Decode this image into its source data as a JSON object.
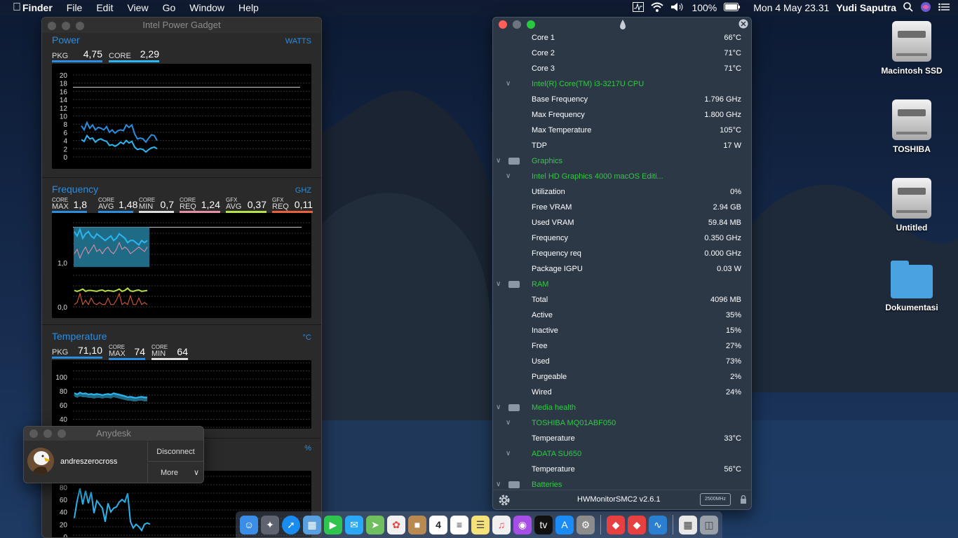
{
  "menubar": {
    "apple": "",
    "app": "Finder",
    "items": [
      "File",
      "Edit",
      "View",
      "Go",
      "Window",
      "Help"
    ],
    "battery": "100%",
    "datetime": "Mon 4 May  23.31",
    "user": "Yudi Saputra"
  },
  "ipg": {
    "title": "Intel Power Gadget",
    "power": {
      "title": "Power",
      "unit": "WATTS",
      "pkg_label": "PKG",
      "pkg_value": "4,75",
      "core_label": "CORE",
      "core_value": "2,29",
      "ticks": [
        "20",
        "18",
        "16",
        "14",
        "12",
        "10",
        "8",
        "6",
        "4",
        "2",
        "0"
      ],
      "pkg_series": [
        7.6,
        6.6,
        8.4,
        7,
        7.8,
        6.6,
        7.2,
        7,
        6.6,
        7.4,
        6,
        6.6,
        5.8,
        6.4,
        6.6,
        6.4,
        7.8,
        7.2,
        7.8,
        5.6,
        4.4,
        4.6,
        4.4,
        3.6,
        4.6,
        5.4,
        5.2,
        4
      ],
      "core_series": [
        4.2,
        3.8,
        5.2,
        4.4,
        4.6,
        3.6,
        4.2,
        4.4,
        4,
        3.8,
        2.8,
        3,
        2.6,
        3,
        3.6,
        3.2,
        4,
        3.4,
        3.8,
        2.4,
        1.8,
        2,
        1.8,
        1.2,
        1.8,
        2.2,
        2.4,
        2
      ]
    },
    "frequency": {
      "title": "Frequency",
      "unit": "GHZ",
      "metrics": [
        {
          "top": "CORE",
          "bottom": "MAX",
          "value": "1,8",
          "color": "#2b8de0"
        },
        {
          "top": "CORE",
          "bottom": "AVG",
          "value": "1,48",
          "color": "#2b8de0"
        },
        {
          "top": "CORE",
          "bottom": "MIN",
          "value": "0,7",
          "color": "#dddddd"
        },
        {
          "top": "CORE",
          "bottom": "REQ",
          "value": "1,24",
          "color": "#e88fa8"
        },
        {
          "top": "GFX",
          "bottom": "AVG",
          "value": "0,37",
          "color": "#b8e04a"
        },
        {
          "top": "GFX",
          "bottom": "REQ",
          "value": "0,11",
          "color": "#e8603c"
        }
      ],
      "ticks": [
        "1,0",
        "0,0"
      ]
    },
    "temperature": {
      "title": "Temperature",
      "unit": "°C",
      "pkg_label": "PKG",
      "pkg_value": "71,10",
      "max_top": "CORE",
      "max_bottom": "MAX",
      "max_value": "74",
      "min_top": "CORE",
      "min_bottom": "MIN",
      "min_value": "64",
      "ticks": [
        "100",
        "80",
        "60",
        "40"
      ]
    },
    "utilization": {
      "unit": "%",
      "ticks": [
        "80",
        "60",
        "40",
        "20",
        "0"
      ],
      "series": [
        30,
        58,
        78,
        52,
        74,
        54,
        72,
        38,
        58,
        52,
        46,
        24,
        54,
        40,
        46,
        48,
        56,
        60,
        56,
        70,
        24,
        14,
        20,
        16,
        10,
        20,
        22,
        20
      ]
    }
  },
  "hwmonitor": {
    "rows": [
      {
        "type": "item",
        "name": "Core 1",
        "value": "66°C"
      },
      {
        "type": "item",
        "name": "Core 2",
        "value": "71°C"
      },
      {
        "type": "item",
        "name": "Core 3",
        "value": "71°C"
      },
      {
        "type": "group",
        "name": "Intel(R) Core(TM) i3-3217U CPU",
        "value": "",
        "chev": true
      },
      {
        "type": "item",
        "name": "Base Frequency",
        "value": "1.796 GHz"
      },
      {
        "type": "item",
        "name": "Max Frequency",
        "value": "1.800 GHz"
      },
      {
        "type": "item",
        "name": "Max Temperature",
        "value": "105°C"
      },
      {
        "type": "item",
        "name": "TDP",
        "value": "17 W"
      },
      {
        "type": "group",
        "name": "Graphics",
        "value": "",
        "chev": true,
        "icon": true
      },
      {
        "type": "group",
        "name": "Intel HD Graphics 4000 macOS Editi...",
        "value": "",
        "chev": true
      },
      {
        "type": "item",
        "name": "Utilization",
        "value": "0%"
      },
      {
        "type": "item",
        "name": "Free VRAM",
        "value": "2.94 GB"
      },
      {
        "type": "item",
        "name": "Used VRAM",
        "value": "59.84 MB"
      },
      {
        "type": "item",
        "name": "Frequency",
        "value": "0.350 GHz"
      },
      {
        "type": "item",
        "name": "Frequency req",
        "value": "0.000 GHz"
      },
      {
        "type": "item",
        "name": "Package IGPU",
        "value": "0.03 W"
      },
      {
        "type": "group",
        "name": "RAM",
        "value": "",
        "chev": true,
        "icon": true
      },
      {
        "type": "item",
        "name": "Total",
        "value": "4096 MB"
      },
      {
        "type": "item",
        "name": "Active",
        "value": "35%"
      },
      {
        "type": "item",
        "name": "Inactive",
        "value": "15%"
      },
      {
        "type": "item",
        "name": "Free",
        "value": "27%"
      },
      {
        "type": "item",
        "name": "Used",
        "value": "73%"
      },
      {
        "type": "item",
        "name": "Purgeable",
        "value": "2%"
      },
      {
        "type": "item",
        "name": "Wired",
        "value": "24%"
      },
      {
        "type": "group",
        "name": "Media health",
        "value": "",
        "chev": true,
        "icon": true
      },
      {
        "type": "group",
        "name": "TOSHIBA MQ01ABF050",
        "value": "",
        "chev": true
      },
      {
        "type": "item",
        "name": "Temperature",
        "value": "33°C"
      },
      {
        "type": "group",
        "name": "ADATA SU650",
        "value": "",
        "chev": true
      },
      {
        "type": "item",
        "name": "Temperature",
        "value": "56°C"
      },
      {
        "type": "group",
        "name": "Batteries",
        "value": "",
        "chev": true,
        "icon": true
      }
    ],
    "footer_version": "HWMonitorSMC2 v2.6.1",
    "footer_mhz": "2500MHz"
  },
  "anydesk": {
    "title": "Anydesk",
    "user": "andreszerocross",
    "disconnect": "Disconnect",
    "more": "More"
  },
  "desktop": {
    "icons": [
      "Macintosh SSD",
      "TOSHIBA",
      "Untitled",
      "Dokumentasi"
    ]
  },
  "dock": {
    "date_day": "4"
  },
  "colors": {
    "accent_blue": "#2b8de0",
    "hw_green": "#2ecc40",
    "hw_bg": "#2d3847"
  }
}
